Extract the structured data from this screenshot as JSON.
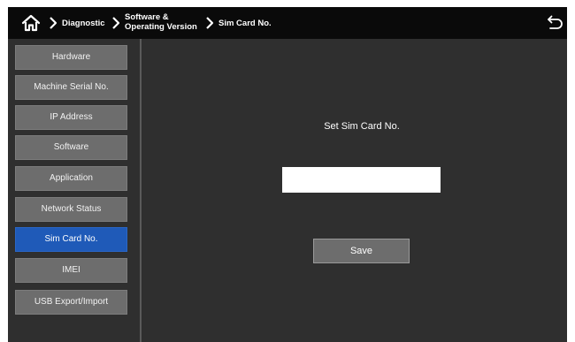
{
  "header": {
    "home_icon": "home-icon",
    "breadcrumbs": [
      {
        "label": "Diagnostic"
      },
      {
        "label_line1": "Software &",
        "label_line2": "Operating Version"
      },
      {
        "label": "Sim Card No."
      }
    ],
    "separator_icon": "chevron-right-icon",
    "back_icon": "undo-arrow-icon"
  },
  "sidebar": {
    "items": [
      {
        "label": "Hardware",
        "active": false
      },
      {
        "label": "Machine Serial No.",
        "active": false
      },
      {
        "label": "IP Address",
        "active": false
      },
      {
        "label": "Software",
        "active": false
      },
      {
        "label": "Application",
        "active": false
      },
      {
        "label": "Network Status",
        "active": false
      },
      {
        "label": "Sim Card No.",
        "active": true
      },
      {
        "label": "IMEI",
        "active": false
      },
      {
        "label": "USB Export/Import",
        "active": false
      }
    ]
  },
  "main": {
    "title": "Set Sim Card No.",
    "input_value": "",
    "save_label": "Save"
  },
  "colors": {
    "header_bg": "#0a0a0a",
    "panel_bg": "#2f2f2f",
    "button_bg": "#6d6d6d",
    "active_bg": "#1f5ab8",
    "text": "#ffffff"
  }
}
